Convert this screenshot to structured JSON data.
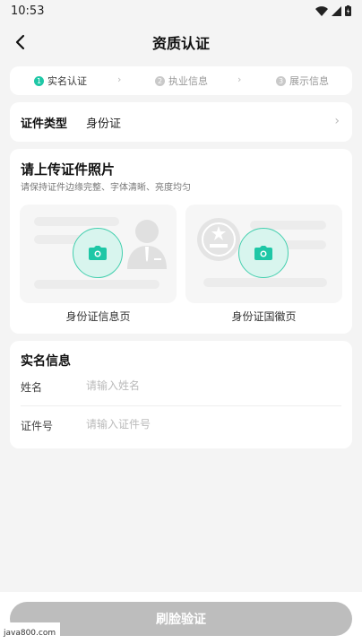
{
  "status_bar": {
    "time": "10:53"
  },
  "nav": {
    "title": "资质认证"
  },
  "steps": [
    {
      "num": "1",
      "label": "实名认证"
    },
    {
      "num": "2",
      "label": "执业信息"
    },
    {
      "num": "3",
      "label": "展示信息"
    }
  ],
  "step_arrow": "›",
  "doc_type": {
    "label": "证件类型",
    "value": "身份证"
  },
  "upload": {
    "title": "请上传证件照片",
    "hint": "请保持证件边缘完整、字体清晰、亮度均匀",
    "front_caption": "身份证信息页",
    "back_caption": "身份证国徽页"
  },
  "realname": {
    "title": "实名信息",
    "name_label": "姓名",
    "name_placeholder": "请输入姓名",
    "id_label": "证件号",
    "id_placeholder": "请输入证件号"
  },
  "bottom": {
    "button_label": "刷脸验证"
  },
  "watermark": "java800.com",
  "colors": {
    "accent": "#1ec7a6",
    "disabled_button": "#bdbdbd",
    "background": "#f4f4f4"
  }
}
